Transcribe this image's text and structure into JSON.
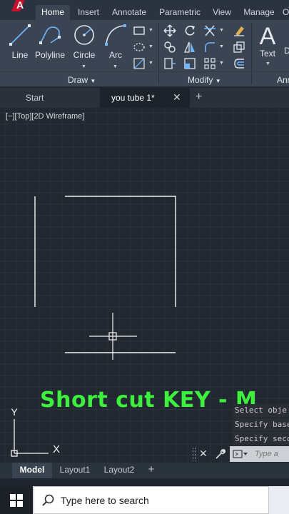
{
  "ribbon_tabs": [
    {
      "label": "Home",
      "active": true
    },
    {
      "label": "Insert"
    },
    {
      "label": "Annotate"
    },
    {
      "label": "Parametric"
    },
    {
      "label": "View"
    },
    {
      "label": "Manage"
    }
  ],
  "draw_panel": {
    "title": "Draw",
    "tools": [
      "Line",
      "Polyline",
      "Circle",
      "Arc"
    ]
  },
  "modify_panel": {
    "title": "Modify"
  },
  "annotation_panel": {
    "title_partial": "Ann",
    "text_tool": "Text"
  },
  "file_tabs": [
    {
      "label": "Start"
    },
    {
      "label": "you tube 1*",
      "active": true
    }
  ],
  "viewport_controls": "[−][Top][2D Wireframe]",
  "caption": "Short cut KEY - M",
  "ucs": {
    "y_label": "Y",
    "x_label": "X"
  },
  "command_history": [
    "Select obje",
    "Specify base",
    "Specify seco"
  ],
  "command_input": {
    "placeholder": "Type a"
  },
  "layout_tabs": [
    {
      "label": "Model",
      "active": true
    },
    {
      "label": "Layout1"
    },
    {
      "label": "Layout2"
    }
  ],
  "taskbar": {
    "search_placeholder": "Type here to search"
  },
  "colors": {
    "canvas": "#212830",
    "ribbon": "#3b4453",
    "caption": "#3df03d",
    "logo": "#c8102e"
  }
}
